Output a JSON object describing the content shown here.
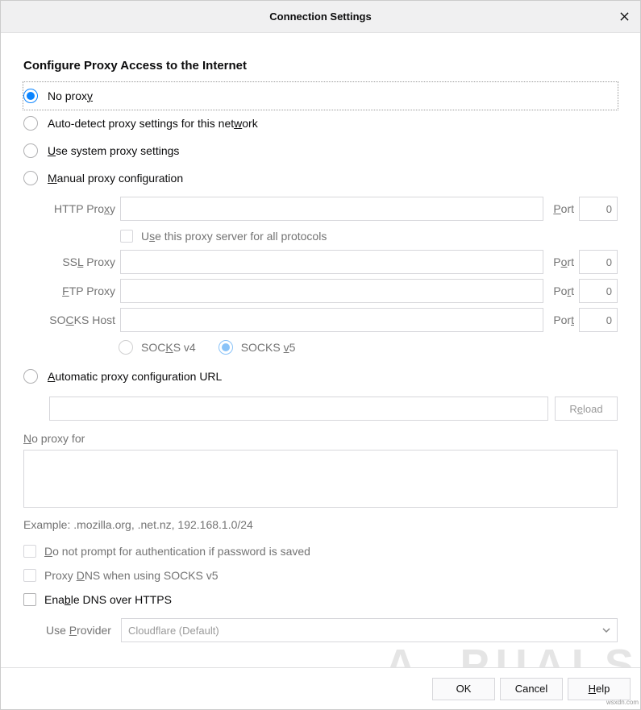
{
  "titlebar": {
    "title": "Connection Settings"
  },
  "heading": "Configure Proxy Access to the Internet",
  "radios": {
    "no_proxy": {
      "pre": "No prox",
      "u": "y"
    },
    "auto_detect": {
      "pre": "Auto-detect proxy settings for this net",
      "u": "w",
      "post": "ork"
    },
    "system": {
      "u": "U",
      "post": "se system proxy settings"
    },
    "manual": {
      "u": "M",
      "post": "anual proxy configuration"
    },
    "auto_url": {
      "u": "A",
      "post": "utomatic proxy configuration URL"
    }
  },
  "manual": {
    "http_label_pre": "HTTP Pro",
    "http_label_u": "x",
    "http_label_post": "y",
    "http_value": "",
    "port_label_u": "P",
    "port_label_post": "ort",
    "http_port": "0",
    "use_for_all": {
      "pre": "U",
      "u": "s",
      "post": "e this proxy server for all protocols"
    },
    "ssl_label_pre": "SS",
    "ssl_label_u": "L",
    "ssl_label_post": " Proxy",
    "ssl_value": "",
    "ssl_port_label_pre": "P",
    "ssl_port_label_u": "o",
    "ssl_port_label_post": "rt",
    "ssl_port": "0",
    "ftp_label_u": "F",
    "ftp_label_post": "TP Proxy",
    "ftp_value": "",
    "ftp_port_label_pre": "Po",
    "ftp_port_label_u": "r",
    "ftp_port_label_post": "t",
    "ftp_port": "0",
    "socks_label_pre": "SO",
    "socks_label_u": "C",
    "socks_label_post": "KS Host",
    "socks_value": "",
    "socks_port_label_pre": "Por",
    "socks_port_label_u": "t",
    "socks_port": "0",
    "socks_v4_pre": "SOC",
    "socks_v4_u": "K",
    "socks_v4_post": "S v4",
    "socks_v5_pre": "SOCKS ",
    "socks_v5_u": "v",
    "socks_v5_post": "5"
  },
  "auto_url": {
    "value": "",
    "reload_pre": "R",
    "reload_u": "e",
    "reload_post": "load"
  },
  "no_proxy_for": {
    "label_u": "N",
    "label_post": "o proxy for",
    "value": ""
  },
  "example": "Example: .mozilla.org, .net.nz, 192.168.1.0/24",
  "checks": {
    "no_prompt_auth": {
      "u": "D",
      "post": "o not prompt for authentication if password is saved"
    },
    "proxy_dns": {
      "pre": "Proxy ",
      "u": "D",
      "post": "NS when using SOCKS v5"
    },
    "enable_doh": {
      "pre": "Ena",
      "u": "b",
      "post": "le DNS over HTTPS"
    }
  },
  "provider": {
    "label_pre": "Use ",
    "label_u": "P",
    "label_post": "rovider",
    "value": "Cloudflare (Default)"
  },
  "footer": {
    "ok": "OK",
    "cancel": "Cancel",
    "help_u": "H",
    "help_post": "elp"
  },
  "watermark": "wsxdn.com"
}
